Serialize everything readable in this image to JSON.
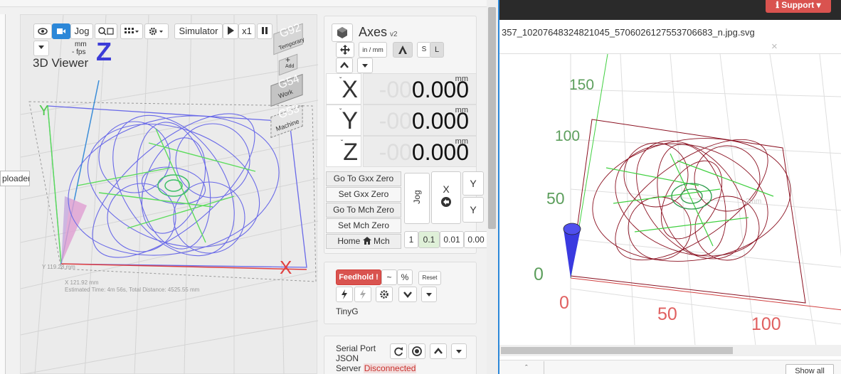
{
  "viewer": {
    "title": "3D Viewer",
    "jog_label": "Jog",
    "simulator_label": "Simulator",
    "speed_label": "x1",
    "units_label": "mm",
    "fps_label": "- fps",
    "z_axis_label": "Z",
    "y_axis_label": "Y",
    "x_axis_label": "X",
    "dims_y": "Y 119.28 mm",
    "dims_x": "X 121.92 mm",
    "estimate": "Estimated Time: 4m 56s, Total Distance: 4525.55 mm",
    "g_buttons": [
      {
        "code": "G92",
        "label": "Temporary"
      },
      {
        "code": "+",
        "label": "Add"
      },
      {
        "code": "G54",
        "label": "Work"
      },
      {
        "code": "G53",
        "label": "Machine"
      }
    ]
  },
  "uploader": {
    "label": "ploader"
  },
  "axes": {
    "title": "Axes",
    "version": "v2",
    "unit_toggle": "in / mm",
    "s_label": "S",
    "l_label": "L",
    "rows": [
      {
        "axis": "X",
        "ghost": "-00",
        "value": "0.000",
        "unit": "mm"
      },
      {
        "axis": "Y",
        "ghost": "-00",
        "value": "0.000",
        "unit": "mm"
      },
      {
        "axis": "Z",
        "ghost": "-00",
        "value": "0.000",
        "unit": "mm"
      }
    ],
    "zero_buttons": [
      "Go To Gxx Zero",
      "Set Gxx Zero",
      "Go To Mch Zero",
      "Set Mch Zero"
    ],
    "home_label": "Mch",
    "home_prefix": "Home",
    "jog_label": "Jog",
    "jog_x": "X",
    "jog_y1": "Y",
    "jog_y2": "Y",
    "steps": [
      "1",
      "0.1",
      "0.01",
      "0.00"
    ]
  },
  "feed": {
    "feedhold": "Feedhold !",
    "tilde": "~",
    "percent": "%",
    "reset": "Reset",
    "controller": "TinyG"
  },
  "serial": {
    "port_label": "Serial Port",
    "json_label": "JSON",
    "server_label": "Server",
    "status": "Disconnected"
  },
  "browser": {
    "support_label": "Support",
    "filename": "357_10207648324821045_5706026127553706683_n.jpg.svg",
    "close": "×",
    "show_all": "Show all"
  },
  "preview": {
    "y_ticks": [
      "150",
      "100",
      "50",
      "0"
    ],
    "x_ticks": [
      "0",
      "50",
      "100"
    ],
    "faint_label": "2mm"
  },
  "colors": {
    "accent": "#2b87d8",
    "danger": "#d9534f",
    "toolpath": "#6a6ae8",
    "green": "#5c9e5c",
    "red_tick": "#e06060"
  }
}
